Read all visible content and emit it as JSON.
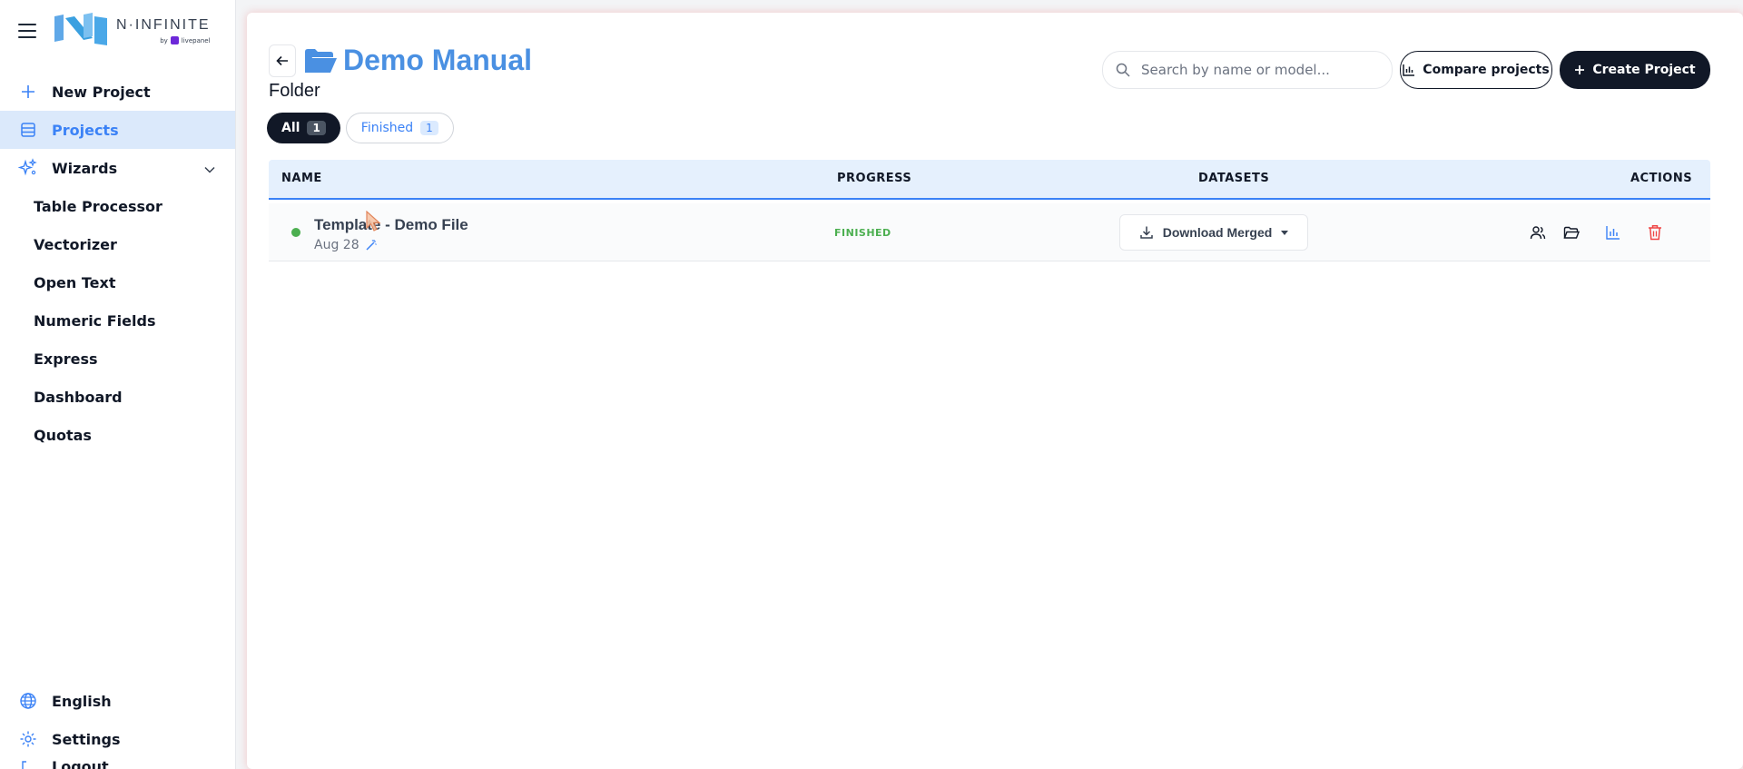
{
  "brand": {
    "name": "N·INFINITE",
    "by": "by",
    "by_brand": "livepanel"
  },
  "sidebar": {
    "items": [
      {
        "label": "New Project",
        "icon": "plus-icon"
      },
      {
        "label": "Projects",
        "icon": "list-icon",
        "active": true
      },
      {
        "label": "Wizards",
        "icon": "sparkles-icon"
      }
    ],
    "wizards": [
      "Table Processor",
      "Vectorizer",
      "Open Text",
      "Numeric Fields",
      "Express",
      "Dashboard",
      "Quotas"
    ],
    "bottom": [
      {
        "label": "English",
        "icon": "globe-icon"
      },
      {
        "label": "Settings",
        "icon": "gear-icon"
      },
      {
        "label": "Logout",
        "icon": "logout-icon"
      }
    ]
  },
  "header": {
    "title": "Demo Manual",
    "subtitle": "Folder",
    "search_placeholder": "Search by name or model...",
    "compare_label": "Compare projects",
    "create_label": "Create Project"
  },
  "tabs": [
    {
      "label": "All",
      "count": "1",
      "active": true
    },
    {
      "label": "Finished",
      "count": "1",
      "active": false
    }
  ],
  "table": {
    "columns": [
      "NAME",
      "PROGRESS",
      "DATASETS",
      "ACTIONS"
    ],
    "rows": [
      {
        "name": "Template - Demo File",
        "date": "Aug 28",
        "status": "FINISHED",
        "dataset_action": "Download Merged"
      }
    ]
  },
  "colors": {
    "accent": "#3b82f6",
    "dark": "#111827",
    "success": "#4caf50",
    "danger": "#ef4444"
  }
}
